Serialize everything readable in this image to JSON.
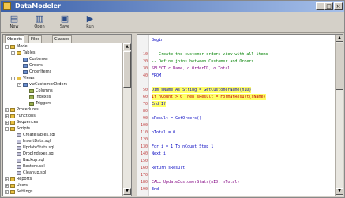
{
  "window": {
    "title": "DataModeler",
    "controls": {
      "minimize": "_",
      "maximize": "□",
      "close": "×"
    }
  },
  "toolbar": {
    "items": [
      {
        "label": "New",
        "icon": "new-file-icon",
        "glyph": "▤"
      },
      {
        "label": "Open",
        "icon": "open-folder-icon",
        "glyph": "▥"
      },
      {
        "label": "Save",
        "icon": "save-icon",
        "glyph": "▣"
      },
      {
        "label": "Run",
        "icon": "run-icon",
        "glyph": "▶"
      }
    ]
  },
  "left_pane": {
    "tabs": [
      "Objects",
      "Files",
      "Classes"
    ],
    "tree": [
      {
        "indent": 0,
        "expander": "-",
        "label": "Model",
        "icon_color": "#e8c040"
      },
      {
        "indent": 1,
        "expander": "-",
        "label": "Tables",
        "icon_color": "#e8c040"
      },
      {
        "indent": 2,
        "expander": "",
        "label": "Customer",
        "icon_color": "#6a8fd0"
      },
      {
        "indent": 2,
        "expander": "",
        "label": "Orders",
        "icon_color": "#6a8fd0"
      },
      {
        "indent": 2,
        "expander": "",
        "label": "OrderItems",
        "icon_color": "#6a8fd0"
      },
      {
        "indent": 1,
        "expander": "-",
        "label": "Views",
        "icon_color": "#e8c040"
      },
      {
        "indent": 2,
        "expander": "-",
        "label": "vwCustomerOrders",
        "icon_color": "#6a8fd0"
      },
      {
        "indent": 3,
        "expander": "",
        "label": "Columns",
        "icon_color": "#9ab050"
      },
      {
        "indent": 3,
        "expander": "",
        "label": "Indexes",
        "icon_color": "#9ab050"
      },
      {
        "indent": 3,
        "expander": "",
        "label": "Triggers",
        "icon_color": "#9ab050"
      },
      {
        "indent": 0,
        "expander": "+",
        "label": "Procedures",
        "icon_color": "#e8c040"
      },
      {
        "indent": 0,
        "expander": "+",
        "label": "Functions",
        "icon_color": "#e8c040"
      },
      {
        "indent": 0,
        "expander": "+",
        "label": "Sequences",
        "icon_color": "#e8c040"
      },
      {
        "indent": 0,
        "expander": "-",
        "label": "Scripts",
        "icon_color": "#e8c040"
      },
      {
        "indent": 1,
        "expander": "",
        "label": "CreateTables.sql",
        "icon_color": "#c0c0d8"
      },
      {
        "indent": 1,
        "expander": "",
        "label": "InsertData.sql",
        "icon_color": "#c0c0d8"
      },
      {
        "indent": 1,
        "expander": "",
        "label": "UpdateStats.sql",
        "icon_color": "#c0c0d8"
      },
      {
        "indent": 1,
        "expander": "",
        "label": "DropIndexes.sql",
        "icon_color": "#c0c0d8"
      },
      {
        "indent": 1,
        "expander": "",
        "label": "Backup.sql",
        "icon_color": "#c0c0d8"
      },
      {
        "indent": 1,
        "expander": "",
        "label": "Restore.sql",
        "icon_color": "#c0c0d8"
      },
      {
        "indent": 1,
        "expander": "",
        "label": "Cleanup.sql",
        "icon_color": "#c0c0d8"
      },
      {
        "indent": 0,
        "expander": "+",
        "label": "Reports",
        "icon_color": "#e8c040"
      },
      {
        "indent": 0,
        "expander": "+",
        "label": "Users",
        "icon_color": "#e8c040"
      },
      {
        "indent": 0,
        "expander": "+",
        "label": "Settings",
        "icon_color": "#e8c040"
      }
    ]
  },
  "editor": {
    "lines": [
      {
        "n": "",
        "text": "Begin",
        "color": "#0000c0",
        "hl": false
      },
      {
        "n": "",
        "text": "",
        "color": "#000",
        "hl": false
      },
      {
        "n": "10",
        "text": "-- Create the customer orders view with all items",
        "color": "#008000",
        "hl": false
      },
      {
        "n": "20",
        "text": "-- Define joins between Customer and Orders",
        "color": "#008000",
        "hl": false
      },
      {
        "n": "30",
        "text": "SELECT c.Name, o.OrderID, o.Total",
        "color": "#800080",
        "hl": false
      },
      {
        "n": "40",
        "text": "FROM",
        "color": "#0000c0",
        "hl": false
      },
      {
        "n": "",
        "text": "",
        "color": "#000",
        "hl": false
      },
      {
        "n": "50",
        "text": "Dim sName As String = GetCustomerName(nID)",
        "color": "#0000c0",
        "hl": true
      },
      {
        "n": "60",
        "text": "If nCount > 0 Then sResult = FormatResult(sName)",
        "color": "#c00000",
        "hl": true
      },
      {
        "n": "70",
        "text": "End If",
        "color": "#0000c0",
        "hl": true
      },
      {
        "n": "80",
        "text": "",
        "color": "#000",
        "hl": false
      },
      {
        "n": "90",
        "text": "    sResult = GetOrders()",
        "color": "#0000c0",
        "hl": false
      },
      {
        "n": "100",
        "text": "",
        "color": "#000",
        "hl": false
      },
      {
        "n": "110",
        "text": "    nTotal = 0",
        "color": "#0000c0",
        "hl": false
      },
      {
        "n": "120",
        "text": "",
        "color": "#000",
        "hl": false
      },
      {
        "n": "130",
        "text": "    For i = 1 To nCount Step 1",
        "color": "#0000c0",
        "hl": false
      },
      {
        "n": "140",
        "text": "Next i",
        "color": "#0000c0",
        "hl": false
      },
      {
        "n": "150",
        "text": "",
        "color": "#000",
        "hl": false
      },
      {
        "n": "160",
        "text": "    Return sResult",
        "color": "#0000c0",
        "hl": false
      },
      {
        "n": "170",
        "text": "",
        "color": "#000",
        "hl": false
      },
      {
        "n": "180",
        "text": "    CALL UpdateCustomerStats(nID, nTotal)",
        "color": "#800080",
        "hl": false
      },
      {
        "n": "190",
        "text": "End",
        "color": "#0000c0",
        "hl": false
      }
    ]
  }
}
